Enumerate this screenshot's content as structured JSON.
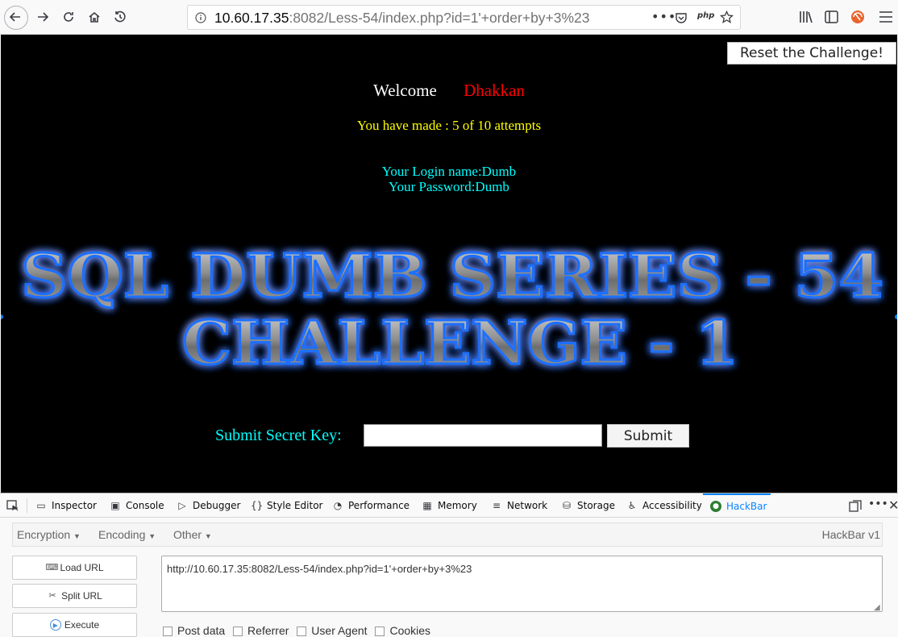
{
  "browser": {
    "url_host": "10.60.17.35",
    "url_rest": ":8082/Less-54/index.php?id=1'+order+by+3%23",
    "page_actions_icon": "ellipsis-icon",
    "pocket_icon": "pocket-icon",
    "php_badge": "php",
    "bookmark_icon": "star-icon"
  },
  "page": {
    "reset_button": "Reset the Challenge!",
    "welcome_label": "Welcome",
    "welcome_name": "Dhakkan",
    "attempts": "You have made : 5 of 10 attempts",
    "login_name": "Your Login name:Dumb",
    "password": "Your Password:Dumb",
    "banner_line1": "SQL DUMB SERIES - 54",
    "banner_line2": "CHALLENGE - 1",
    "secret_label": "Submit Secret Key:",
    "secret_value": "",
    "submit_button": "Submit"
  },
  "devtools": {
    "tabs": [
      {
        "label": "Inspector",
        "icon": "inspector-icon"
      },
      {
        "label": "Console",
        "icon": "console-icon"
      },
      {
        "label": "Debugger",
        "icon": "debugger-icon"
      },
      {
        "label": "Style Editor",
        "icon": "style-editor-icon"
      },
      {
        "label": "Performance",
        "icon": "performance-icon"
      },
      {
        "label": "Memory",
        "icon": "memory-icon"
      },
      {
        "label": "Network",
        "icon": "network-icon"
      },
      {
        "label": "Storage",
        "icon": "storage-icon"
      },
      {
        "label": "Accessibility",
        "icon": "accessibility-icon"
      },
      {
        "label": "HackBar",
        "icon": "hackbar-icon",
        "active": true
      }
    ],
    "accent_color": "#0a84ff"
  },
  "hackbar": {
    "menus": [
      "Encryption",
      "Encoding",
      "Other"
    ],
    "version": "HackBar v1",
    "buttons": [
      "Load URL",
      "Split URL",
      "Execute"
    ],
    "url_value": "http://10.60.17.35:8082/Less-54/index.php?id=1'+order+by+3%23",
    "checkboxes": [
      "Post data",
      "Referrer",
      "User Agent",
      "Cookies"
    ]
  }
}
